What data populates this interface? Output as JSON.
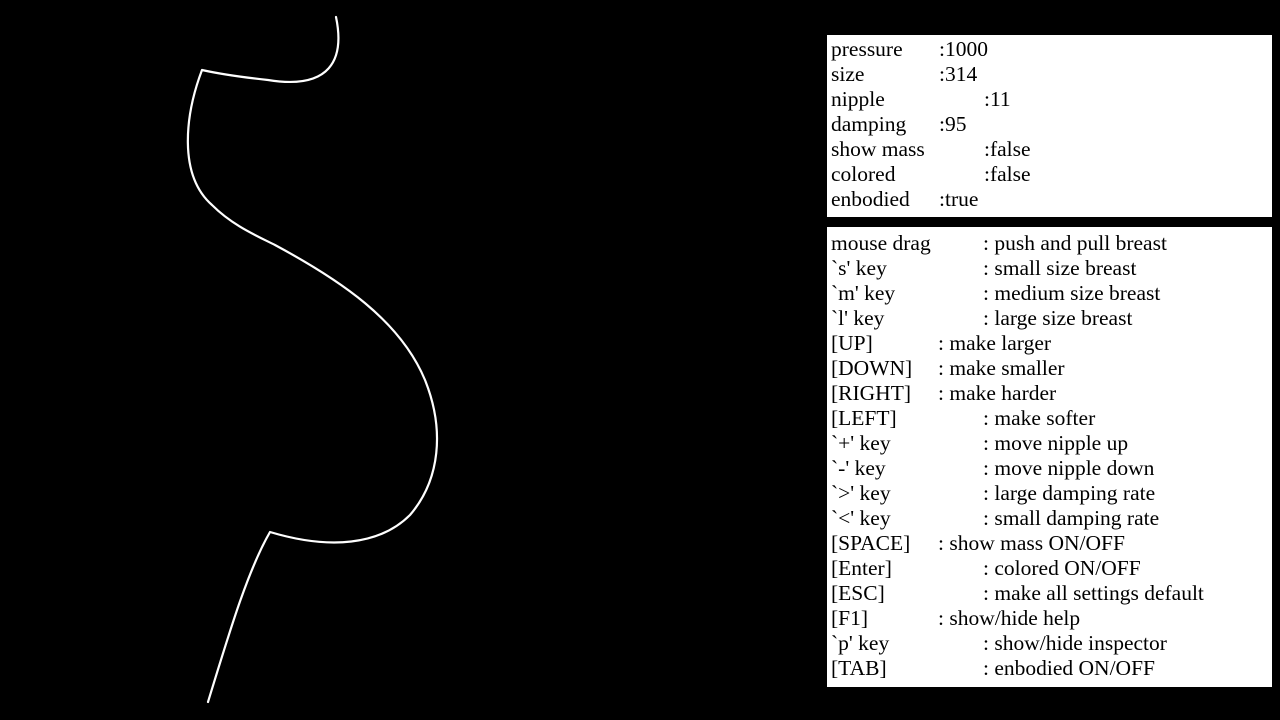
{
  "inspector": {
    "rows": [
      {
        "key": "pressure",
        "value": ":1000"
      },
      {
        "key": "size",
        "value": ":314"
      },
      {
        "key": "nipple",
        "value": ":11"
      },
      {
        "key": "damping",
        "value": ":95"
      },
      {
        "key": "show mass",
        "value": ":false"
      },
      {
        "key": "colored",
        "value": ":false"
      },
      {
        "key": "enbodied",
        "value": ":true"
      }
    ]
  },
  "help": {
    "rows": [
      {
        "key": "mouse drag",
        "value": ": push and pull breast"
      },
      {
        "key": "`s' key",
        "value": ": small size breast"
      },
      {
        "key": "`m' key",
        "value": ": medium size breast"
      },
      {
        "key": "`l' key",
        "value": ": large size breast"
      },
      {
        "key": "[UP]",
        "value": ": make larger"
      },
      {
        "key": "[DOWN]",
        "value": ": make smaller"
      },
      {
        "key": "[RIGHT]",
        "value": ": make harder"
      },
      {
        "key": "[LEFT]",
        "value": ": make softer"
      },
      {
        "key": "`+' key",
        "value": ": move nipple up"
      },
      {
        "key": "`-' key",
        "value": ": move nipple down"
      },
      {
        "key": "`>' key",
        "value": ": large damping rate"
      },
      {
        "key": "`<' key",
        "value": ": small damping rate"
      },
      {
        "key": "[SPACE]",
        "value": ": show mass ON/OFF"
      },
      {
        "key": "[Enter]",
        "value": ": colored ON/OFF"
      },
      {
        "key": "[ESC]",
        "value": ": make all settings default"
      },
      {
        "key": "[F1]",
        "value": ": show/hide help"
      },
      {
        "key": "`p' key",
        "value": ": show/hide inspector"
      },
      {
        "key": "[TAB]",
        "value": ": enbodied ON/OFF"
      }
    ]
  },
  "colors": {
    "background": "#000000",
    "outline": "#ffffff",
    "panel": "#ffffff",
    "text": "#000000"
  }
}
